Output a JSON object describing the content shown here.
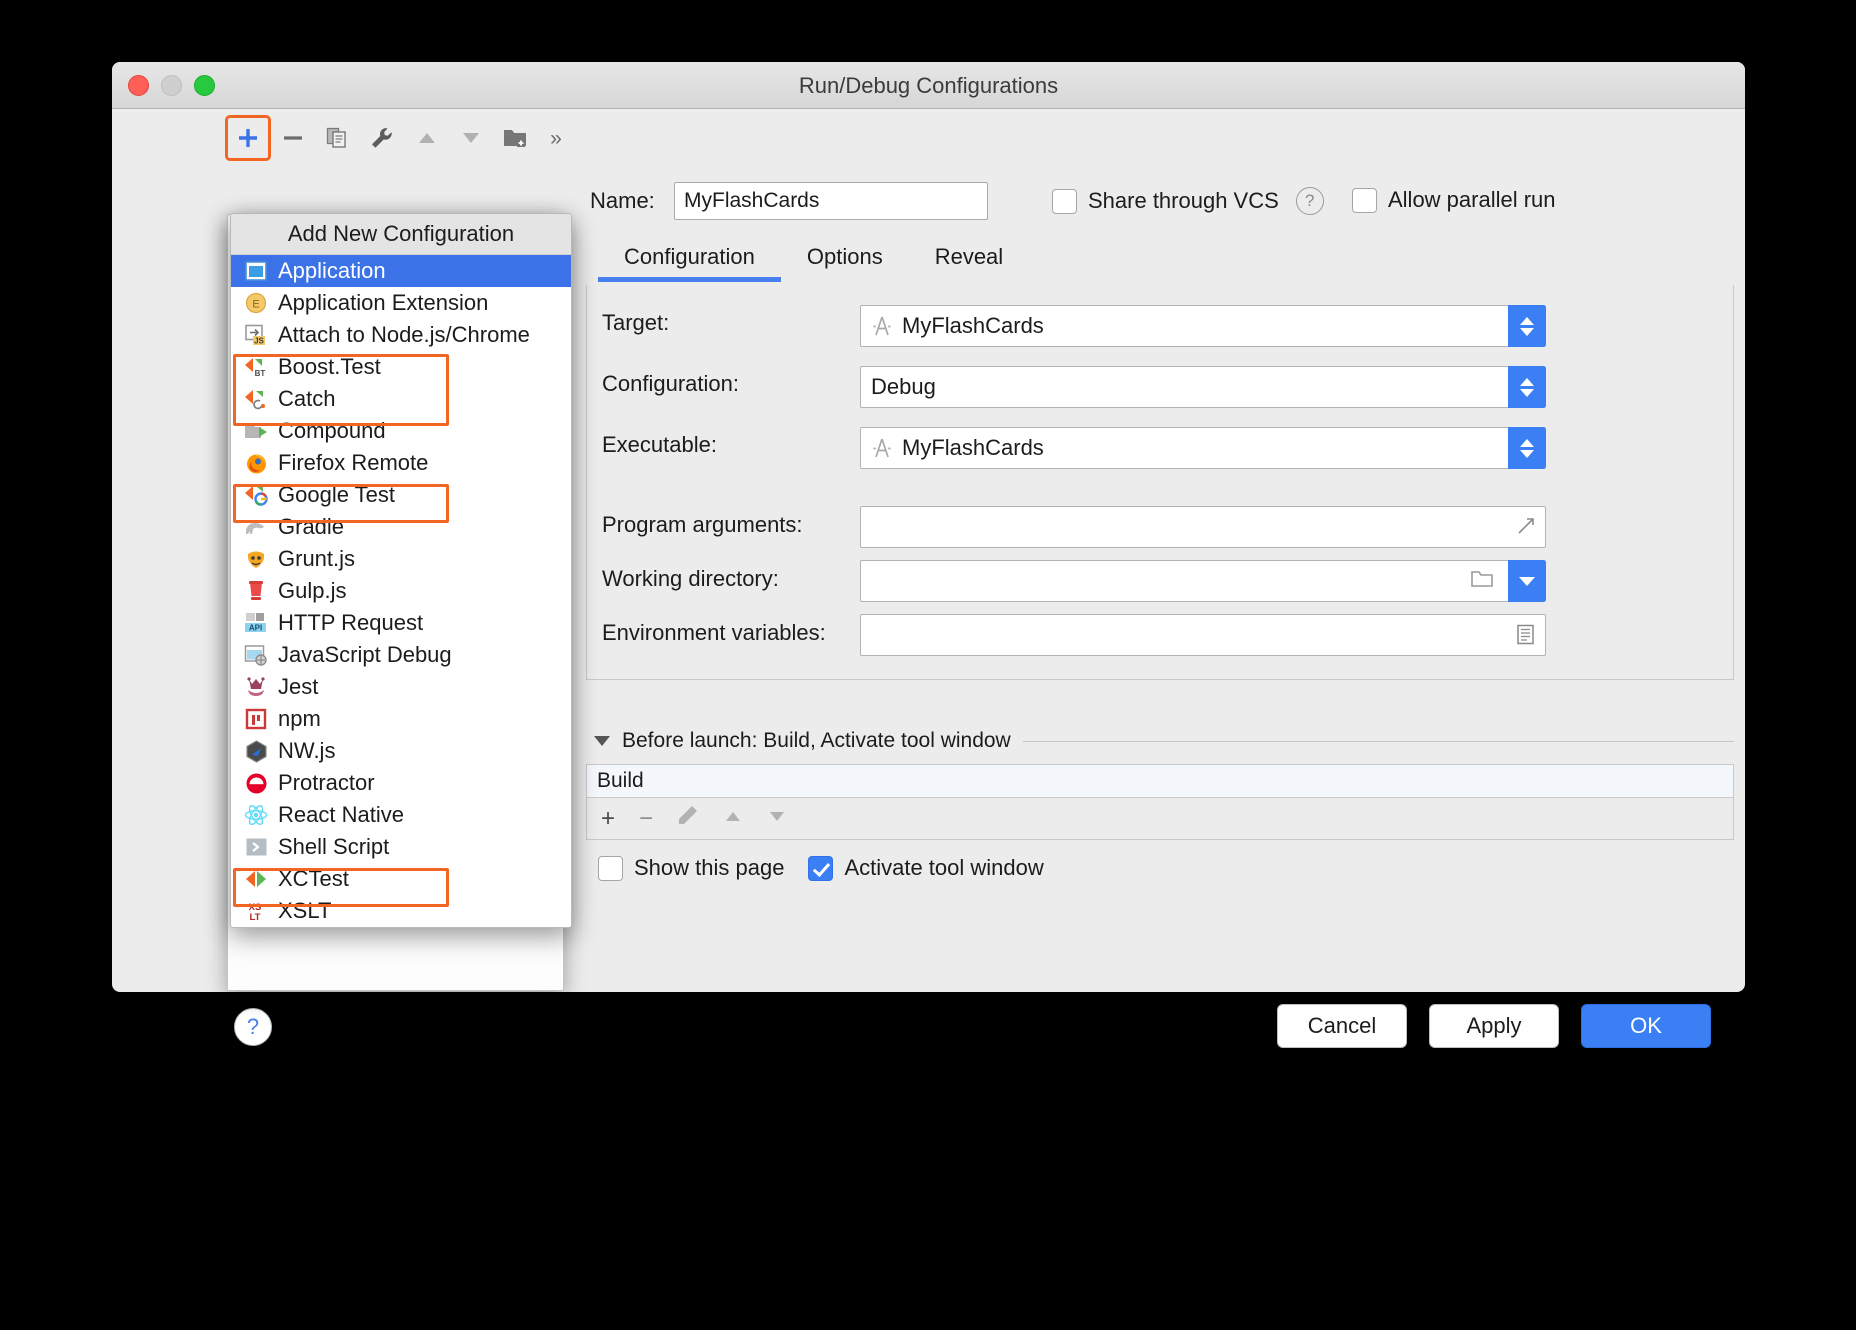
{
  "window": {
    "title": "Run/Debug Configurations",
    "traffic_lights": [
      "close",
      "minimize",
      "zoom"
    ]
  },
  "toolbar": {
    "items": [
      {
        "name": "add-configuration",
        "glyph": "+",
        "highlighted": true
      },
      {
        "name": "remove-configuration",
        "glyph": "−",
        "highlighted": false
      },
      {
        "name": "copy-configuration",
        "glyph": "❐",
        "highlighted": false
      },
      {
        "name": "edit-templates",
        "glyph": "wrench",
        "highlighted": false
      },
      {
        "name": "move-up",
        "glyph": "▲",
        "highlighted": false
      },
      {
        "name": "move-down",
        "glyph": "▼",
        "highlighted": false
      },
      {
        "name": "new-folder",
        "glyph": "folder-plus",
        "highlighted": false
      },
      {
        "name": "more-options",
        "glyph": "»",
        "highlighted": false
      }
    ]
  },
  "name_row": {
    "label": "Name:",
    "value": "MyFlashCards",
    "placeholder": "",
    "share_through_vcs": {
      "label": "Share through VCS",
      "checked": false,
      "help": "?"
    },
    "allow_parallel_run": {
      "label": "Allow parallel run",
      "checked": false
    }
  },
  "tabs": [
    {
      "label": "Configuration",
      "active": true
    },
    {
      "label": "Options",
      "active": false
    },
    {
      "label": "Reveal",
      "active": false
    }
  ],
  "configuration_form": {
    "fields": [
      {
        "label": "Target:",
        "value": "MyFlashCards",
        "control": "stepper",
        "icon": "xcode-target-icon"
      },
      {
        "label": "Configuration:",
        "value": "Debug",
        "control": "stepper",
        "icon": ""
      },
      {
        "label": "Executable:",
        "value": "MyFlashCards",
        "control": "stepper",
        "icon": "xcode-target-icon"
      },
      {
        "label": "Program arguments:",
        "value": "",
        "control": "expand",
        "icon": ""
      },
      {
        "label": "Working directory:",
        "value": "",
        "control": "folder-dropdown",
        "icon": ""
      },
      {
        "label": "Environment variables:",
        "value": "",
        "control": "env-editor",
        "icon": ""
      }
    ]
  },
  "before_launch": {
    "title": "Before launch: Build, Activate tool window",
    "tasks": [
      "Build"
    ],
    "task_toolbar": [
      {
        "name": "add-task",
        "glyph": "+"
      },
      {
        "name": "remove-task",
        "glyph": "−"
      },
      {
        "name": "edit-task",
        "glyph": "✎"
      },
      {
        "name": "move-task-up",
        "glyph": "▲"
      },
      {
        "name": "move-task-down",
        "glyph": "▼"
      }
    ],
    "show_this_page": {
      "label": "Show this page",
      "checked": false
    },
    "activate_tool_window": {
      "label": "Activate tool window",
      "checked": true
    }
  },
  "footer": {
    "help": "?",
    "cancel": "Cancel",
    "apply": "Apply",
    "ok": "OK"
  },
  "dropdown": {
    "header": "Add New Configuration",
    "items": [
      {
        "label": "Application",
        "icon": "application-icon",
        "selected": true,
        "highlighted": false
      },
      {
        "label": "Application Extension",
        "icon": "extension-icon",
        "selected": false,
        "highlighted": false
      },
      {
        "label": "Attach to Node.js/Chrome",
        "icon": "attach-node-icon",
        "selected": false,
        "highlighted": false
      },
      {
        "label": "Boost.Test",
        "icon": "boost-test-icon",
        "selected": false,
        "highlighted": true
      },
      {
        "label": "Catch",
        "icon": "catch-icon",
        "selected": false,
        "highlighted": true
      },
      {
        "label": "Compound",
        "icon": "compound-icon",
        "selected": false,
        "highlighted": false
      },
      {
        "label": "Firefox Remote",
        "icon": "firefox-icon",
        "selected": false,
        "highlighted": false
      },
      {
        "label": "Google Test",
        "icon": "google-test-icon",
        "selected": false,
        "highlighted": true
      },
      {
        "label": "Gradle",
        "icon": "gradle-icon",
        "selected": false,
        "highlighted": false
      },
      {
        "label": "Grunt.js",
        "icon": "grunt-icon",
        "selected": false,
        "highlighted": false
      },
      {
        "label": "Gulp.js",
        "icon": "gulp-icon",
        "selected": false,
        "highlighted": false
      },
      {
        "label": "HTTP Request",
        "icon": "http-request-icon",
        "selected": false,
        "highlighted": false
      },
      {
        "label": "JavaScript Debug",
        "icon": "javascript-debug-icon",
        "selected": false,
        "highlighted": false
      },
      {
        "label": "Jest",
        "icon": "jest-icon",
        "selected": false,
        "highlighted": false
      },
      {
        "label": "npm",
        "icon": "npm-icon",
        "selected": false,
        "highlighted": false
      },
      {
        "label": "NW.js",
        "icon": "nwjs-icon",
        "selected": false,
        "highlighted": false
      },
      {
        "label": "Protractor",
        "icon": "protractor-icon",
        "selected": false,
        "highlighted": false
      },
      {
        "label": "React Native",
        "icon": "react-native-icon",
        "selected": false,
        "highlighted": false
      },
      {
        "label": "Shell Script",
        "icon": "shell-script-icon",
        "selected": false,
        "highlighted": false
      },
      {
        "label": "XCTest",
        "icon": "xctest-icon",
        "selected": false,
        "highlighted": true
      },
      {
        "label": "XSLT",
        "icon": "xslt-icon",
        "selected": false,
        "highlighted": false
      }
    ]
  },
  "colors": {
    "accent": "#3b7ff5",
    "selection": "#3b72e8",
    "highlight_outline": "#f26522",
    "window_bg": "#ececec"
  }
}
